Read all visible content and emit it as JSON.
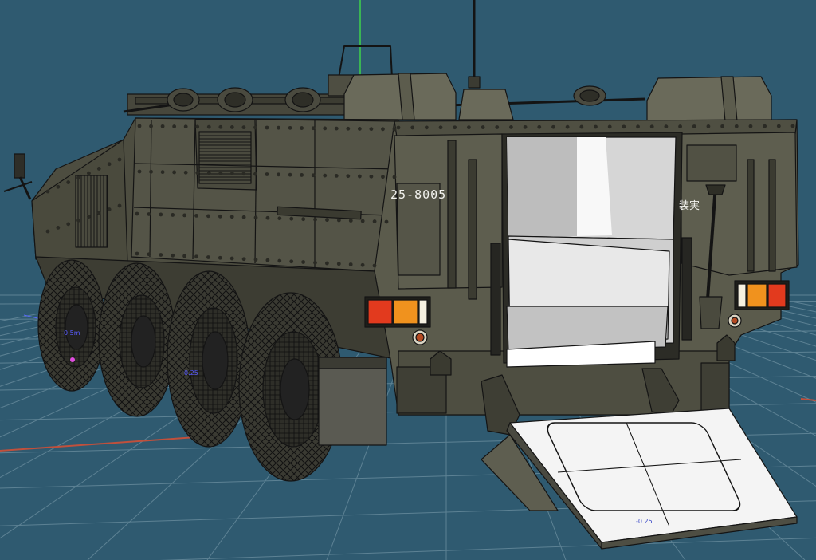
{
  "viewport": {
    "background": "#2f5a70",
    "grid_color": "#5d8294",
    "x_axis_color": "#c0503c",
    "y_axis_color": "#3fd24a"
  },
  "vehicle": {
    "hull_color": "#4d4d40",
    "panel_color": "#56564a",
    "line_color": "#141414",
    "registration": "25-8005",
    "rear_marking": "装実",
    "interior_color": "#d6d6d6",
    "ramp_color": "#f4f4f4"
  },
  "dimension_labels": {
    "wheel_top": "0.5m",
    "wheel_mid": "0.25",
    "ramp": "-0.25"
  },
  "lights": {
    "red": "#e23a1e",
    "amber": "#f0921e",
    "white": "#f6f1e0"
  }
}
